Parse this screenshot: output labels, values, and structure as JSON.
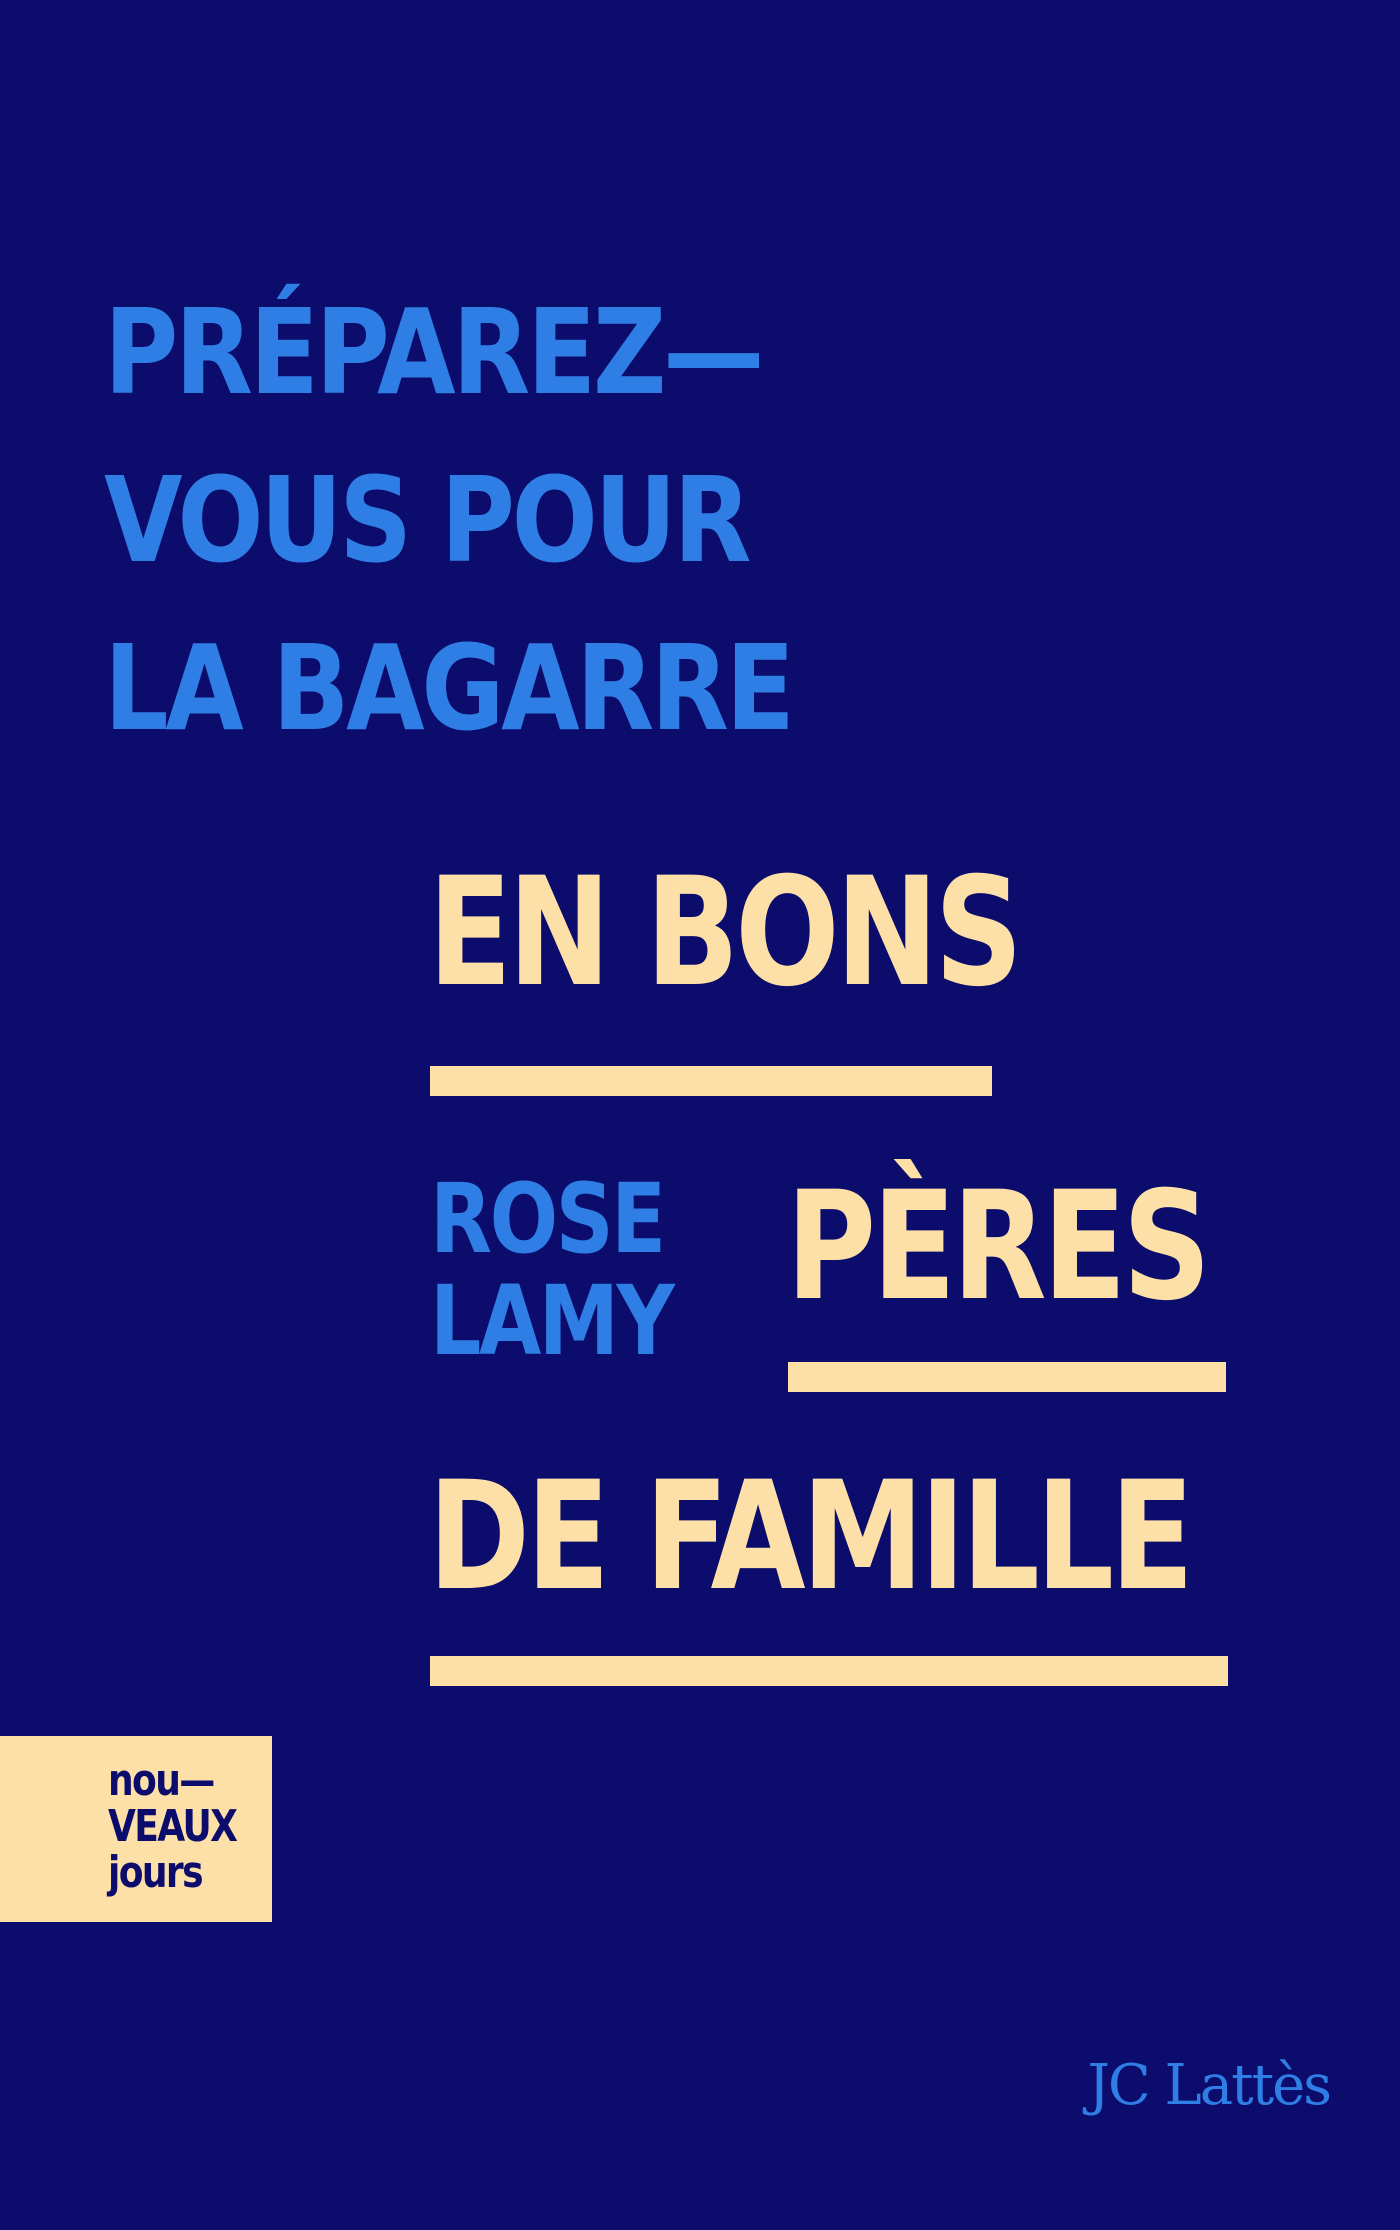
{
  "tagline": {
    "lines": [
      "PRÉPAREZ—",
      "VOUS POUR",
      "LA BAGARRE"
    ]
  },
  "title": {
    "lines": [
      "EN BONS",
      "PÈRES",
      "DE FAMILLE"
    ]
  },
  "author": {
    "first": "ROSE",
    "last": "LAMY"
  },
  "collection": {
    "lines": [
      "nou—",
      "VEAUX",
      "jours"
    ]
  },
  "publisher": "JC Lattès",
  "colors": {
    "background": "#0b0c6b",
    "accent_blue": "#2f7ee6",
    "cream": "#fde0a8"
  }
}
